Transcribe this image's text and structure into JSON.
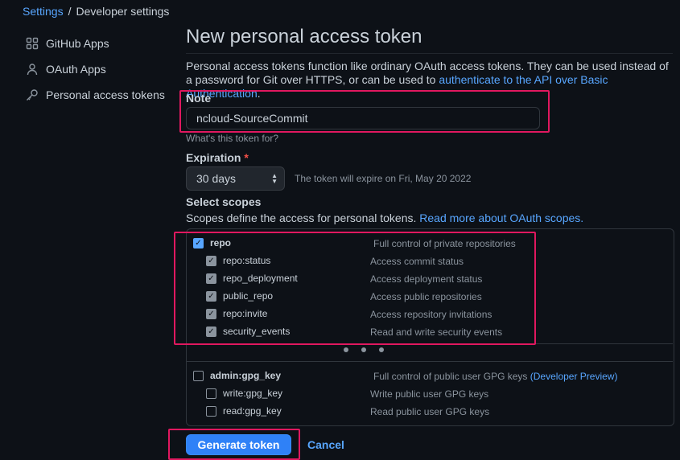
{
  "breadcrumb": {
    "root": "Settings",
    "separator": "/",
    "current": "Developer settings"
  },
  "sidebar": {
    "items": [
      {
        "label": "GitHub Apps",
        "icon": "apps-grid-icon"
      },
      {
        "label": "OAuth Apps",
        "icon": "person-icon"
      },
      {
        "label": "Personal access tokens",
        "icon": "key-icon"
      }
    ]
  },
  "page": {
    "title": "New personal access token",
    "description": "Personal access tokens function like ordinary OAuth access tokens. They can be used instead of a password for Git over HTTPS, or can be used to ",
    "description_link": "authenticate to the API over Basic Authentication",
    "description_end": "."
  },
  "note": {
    "label": "Note",
    "value": "ncloud-SourceCommit",
    "hint": "What's this token for?"
  },
  "expiration": {
    "label": "Expiration",
    "required_mark": "*",
    "selected": "30 days",
    "note": "The token will expire on Fri, May 20 2022"
  },
  "scopes": {
    "heading": "Select scopes",
    "description": "Scopes define the access for personal tokens. ",
    "description_link": "Read more about OAuth scopes.",
    "repo": {
      "name": "repo",
      "desc": "Full control of private repositories",
      "checked": true,
      "children": [
        {
          "name": "repo:status",
          "desc": "Access commit status"
        },
        {
          "name": "repo_deployment",
          "desc": "Access deployment status"
        },
        {
          "name": "public_repo",
          "desc": "Access public repositories"
        },
        {
          "name": "repo:invite",
          "desc": "Access repository invitations"
        },
        {
          "name": "security_events",
          "desc": "Read and write security events"
        }
      ]
    },
    "gpg": {
      "name": "admin:gpg_key",
      "desc": "Full control of public user GPG keys",
      "desc_link": "(Developer Preview)",
      "children": [
        {
          "name": "write:gpg_key",
          "desc": "Write public user GPG keys"
        },
        {
          "name": "read:gpg_key",
          "desc": "Read public user GPG keys"
        }
      ]
    }
  },
  "actions": {
    "generate": "Generate token",
    "cancel": "Cancel"
  },
  "colors": {
    "accent": "#58a6ff",
    "button": "#2f81f7",
    "highlight": "#e0185f",
    "background": "#0d1117"
  }
}
